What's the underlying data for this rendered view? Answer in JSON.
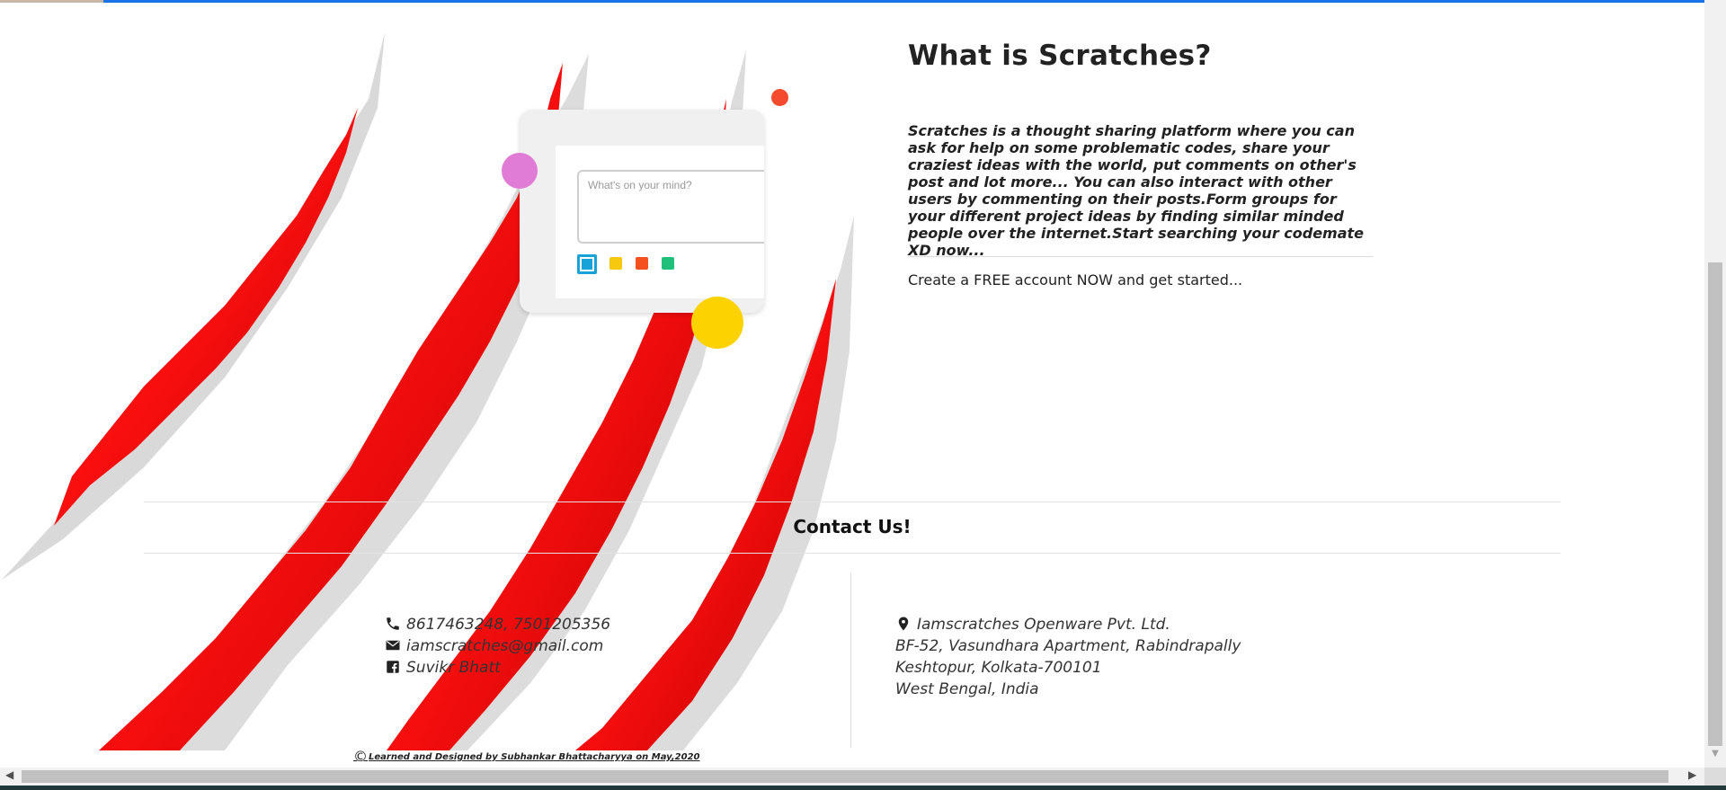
{
  "about": {
    "title": "What is Scratches?",
    "description": "Scratches is a thought sharing platform where you can ask for help on some problematic codes, share your craziest ideas with the world, put comments on other's post and lot more... You can also interact with other users by commenting on their posts.Form groups for your different project ideas by finding similar minded people over the internet.Start searching your codemate XD now...",
    "cta": "Create a FREE account NOW and get started..."
  },
  "mockup": {
    "placeholder": "What's on your mind?",
    "swatches": [
      "#17a3d8",
      "#f6c90e",
      "#f4511e",
      "#21c07a"
    ],
    "dots": [
      "#e07cd6",
      "#f44a2e",
      "#fcd200"
    ]
  },
  "contact": {
    "title": "Contact Us!",
    "phone": "8617463248, 7501205356",
    "email": "iamscratches@gmail.com",
    "facebook": "Suvikr Bhatt",
    "company": "Iamscratches Openware Pvt. Ltd.",
    "address_line1": "BF-52, Vasundhara Apartment, Rabindrapally",
    "address_line2": "Keshtopur, Kolkata-700101",
    "address_line3": "West Bengal, India"
  },
  "footer": {
    "copyright_symbol": "©",
    "credit": "Learned and Designed by Subhankar Bhattacharyya on May,2020"
  },
  "colors": {
    "accent_blue": "#1a73e8",
    "scratch_red": "#e00000"
  }
}
